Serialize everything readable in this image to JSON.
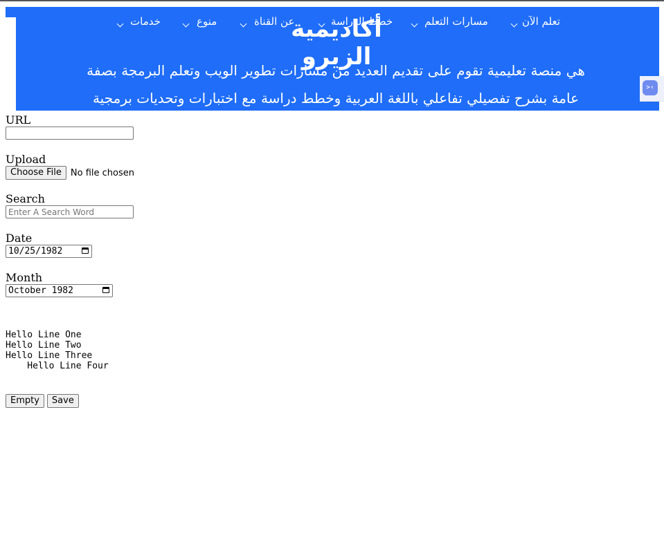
{
  "header": {
    "brand": "أكاديمية الزيرو",
    "description": "هي منصة تعليمية تقوم على تقديم العديد من مسارات تطوير الويب وتعلم البرمجة بصفة عامة بشرح تفصيلي تفاعلي باللغة العربية وخطط دراسة مع اختبارات وتحديات برمجية",
    "nav": {
      "learn_now": "تعلم الآن",
      "learning_paths": "مسارات التعلم",
      "study_plans": "خطط الدراسة",
      "about_channel": "عن القناة",
      "misc": "منوع",
      "services": "خدمات"
    },
    "accent_color": "#1f6df8"
  },
  "side_widget": {
    "icon": "code-icon",
    "glyph": ">‹"
  },
  "form": {
    "url": {
      "label": "URL",
      "value": ""
    },
    "upload": {
      "label": "Upload",
      "button_label": "Choose File",
      "status": "No file chosen"
    },
    "search": {
      "label": "Search",
      "placeholder": "Enter A Search Word",
      "value": ""
    },
    "date": {
      "label": "Date",
      "value": "10/25/1982"
    },
    "month": {
      "label": "Month",
      "value": "October 1982"
    }
  },
  "preformatted": "\nHello Line One\nHello Line Two\nHello Line Three\n    Hello Line Four\n",
  "actions": {
    "empty_label": "Empty",
    "save_label": "Save"
  }
}
